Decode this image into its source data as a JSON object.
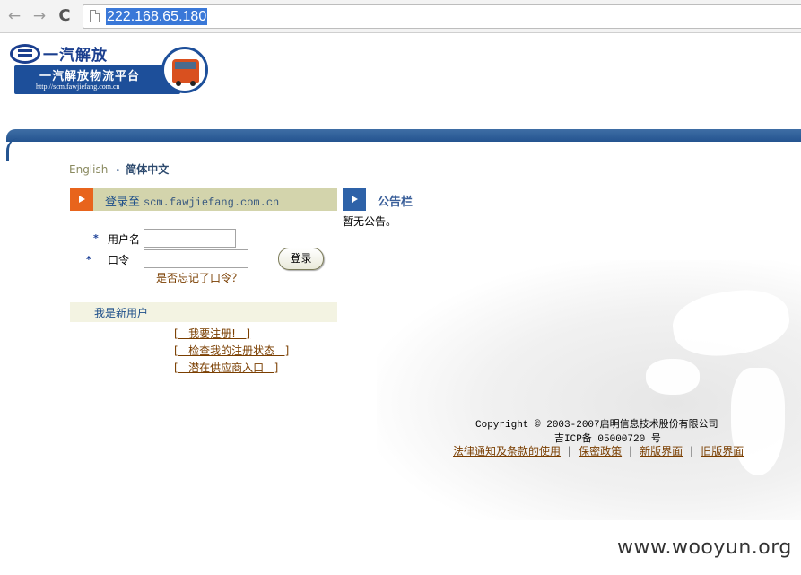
{
  "browser": {
    "back_glyph": "←",
    "forward_glyph": "→",
    "reload_glyph": "C",
    "url": "222.168.65.180"
  },
  "logo": {
    "brand": "一汽解放",
    "platform": "一汽解放物流平台",
    "url_text": "http://scm.fawjiefang.com.cn"
  },
  "language": {
    "english": "English",
    "separator": "•",
    "chinese": "简体中文"
  },
  "login": {
    "title": "登录至",
    "domain": "scm.fawjiefang.com.cn",
    "username_label": "用户名",
    "password_label": "口令",
    "required_mark": "*",
    "username_value": "",
    "password_value": "",
    "submit_label": "登录",
    "forgot_link": "是否忘记了口令？"
  },
  "notice": {
    "title": "公告栏",
    "content": "暂无公告。"
  },
  "new_user": {
    "label": "我是新用户",
    "links": [
      "[   我要注册!   ]",
      "[   检查我的注册状态   ]",
      "[   潜在供应商入口   ]"
    ]
  },
  "footer": {
    "copyright": "Copyright © 2003-2007启明信息技术股份有限公司",
    "icp": "吉ICP备 05000720 号",
    "links": [
      "法律通知及条款的使用",
      "保密政策",
      "新版界面",
      "旧版界面"
    ],
    "separator": "|"
  },
  "watermark": "www.wooyun.org",
  "colors": {
    "banner_blue": "#245490",
    "login_arrow": "#e8641c",
    "notice_arrow": "#2e62a8",
    "link_brown": "#7a3e00",
    "header_bar": "#d3d4ac"
  }
}
